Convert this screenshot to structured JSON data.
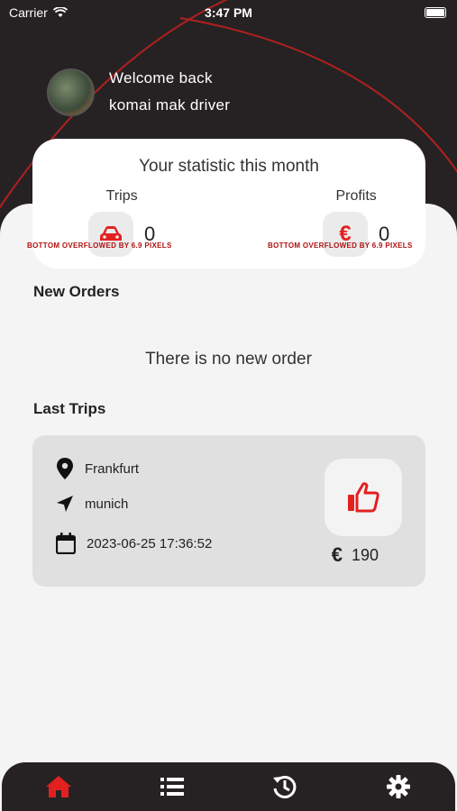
{
  "status_bar": {
    "carrier": "Carrier",
    "time": "3:47 PM"
  },
  "header": {
    "welcome": "Welcome back",
    "username": "komai mak driver"
  },
  "stats": {
    "title": "Your statistic this month",
    "trips_label": "Trips",
    "trips_value": "0",
    "profits_label": "Profits",
    "profits_value": "0",
    "currency_symbol": "€",
    "overflow_warning": "BOTTOM OVERFLOWED BY 6.9 PIXELS"
  },
  "new_orders": {
    "title": "New Orders",
    "empty_message": "There is no new order"
  },
  "last_trips": {
    "title": "Last Trips",
    "items": [
      {
        "from": "Frankfurt",
        "to": "munich",
        "datetime": "2023-06-25 17:36:52",
        "price": "190",
        "currency": "€"
      }
    ]
  },
  "nav": {
    "items": [
      "home-icon",
      "list-icon",
      "history-icon",
      "settings-icon"
    ],
    "active": "home-icon"
  },
  "colors": {
    "accent": "#e32020",
    "dark": "#262223"
  }
}
